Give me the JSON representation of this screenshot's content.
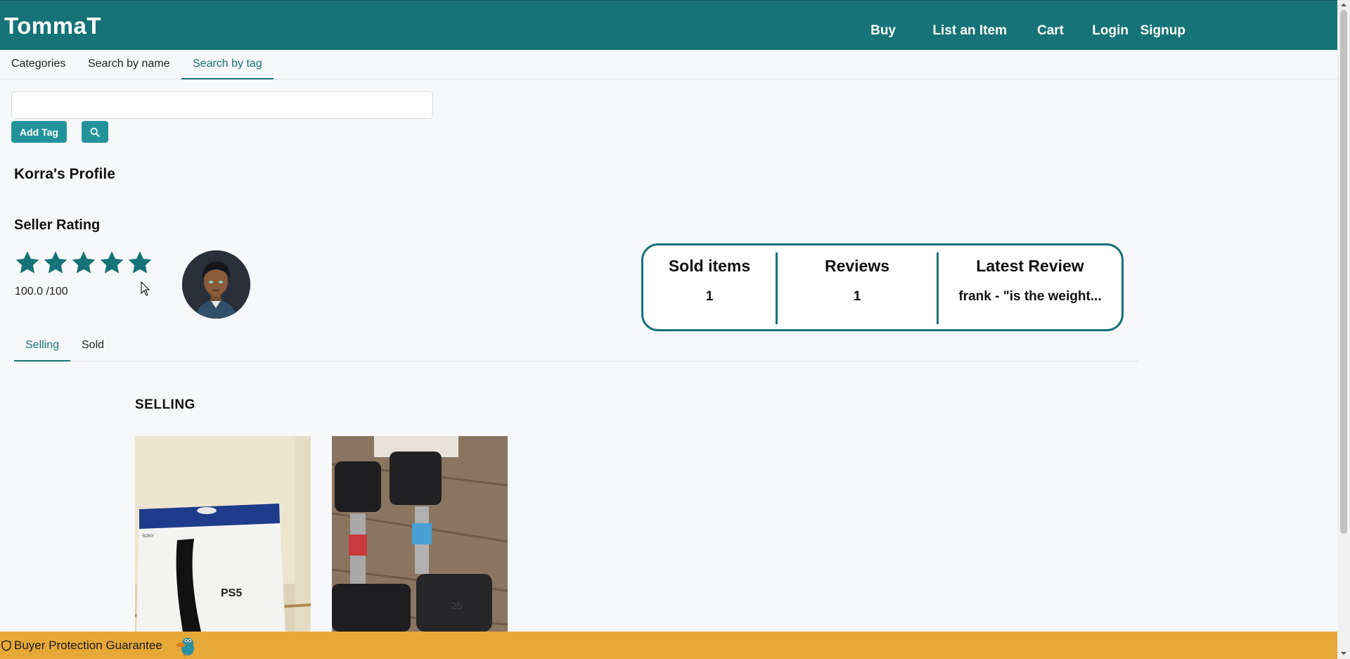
{
  "header": {
    "brand": "TommaT",
    "nav": [
      "Buy",
      "List an Item",
      "Cart",
      "Login",
      "Signup"
    ]
  },
  "search": {
    "tabs": [
      "Categories",
      "Search by name",
      "Search by tag"
    ],
    "active_tab": "Search by tag",
    "tag_input_value": "",
    "add_tag_label": "Add Tag",
    "search_icon": "search-icon"
  },
  "profile": {
    "title": "Korra's Profile",
    "rating_title": "Seller Rating",
    "stars_filled": 5,
    "stars_total": 5,
    "rating_text": "100.0 /100"
  },
  "stats": {
    "sold_label": "Sold items",
    "sold_value": "1",
    "reviews_label": "Reviews",
    "reviews_value": "1",
    "latest_label": "Latest Review",
    "latest_value": "frank - \"is the weight..."
  },
  "profile_tabs": [
    "Selling",
    "Sold"
  ],
  "active_profile_tab": "Selling",
  "selling": {
    "title": "SELLING",
    "items": [
      {
        "image": "ps5-box-photo"
      },
      {
        "image": "dumbbells-photo"
      }
    ]
  },
  "footer": {
    "text": "Buyer Protection Guarantee",
    "icon": "shield-icon",
    "mascot": "platypus-mascot"
  },
  "colors": {
    "primary": "#167378",
    "button": "#23939a",
    "footer": "#e8a838"
  }
}
